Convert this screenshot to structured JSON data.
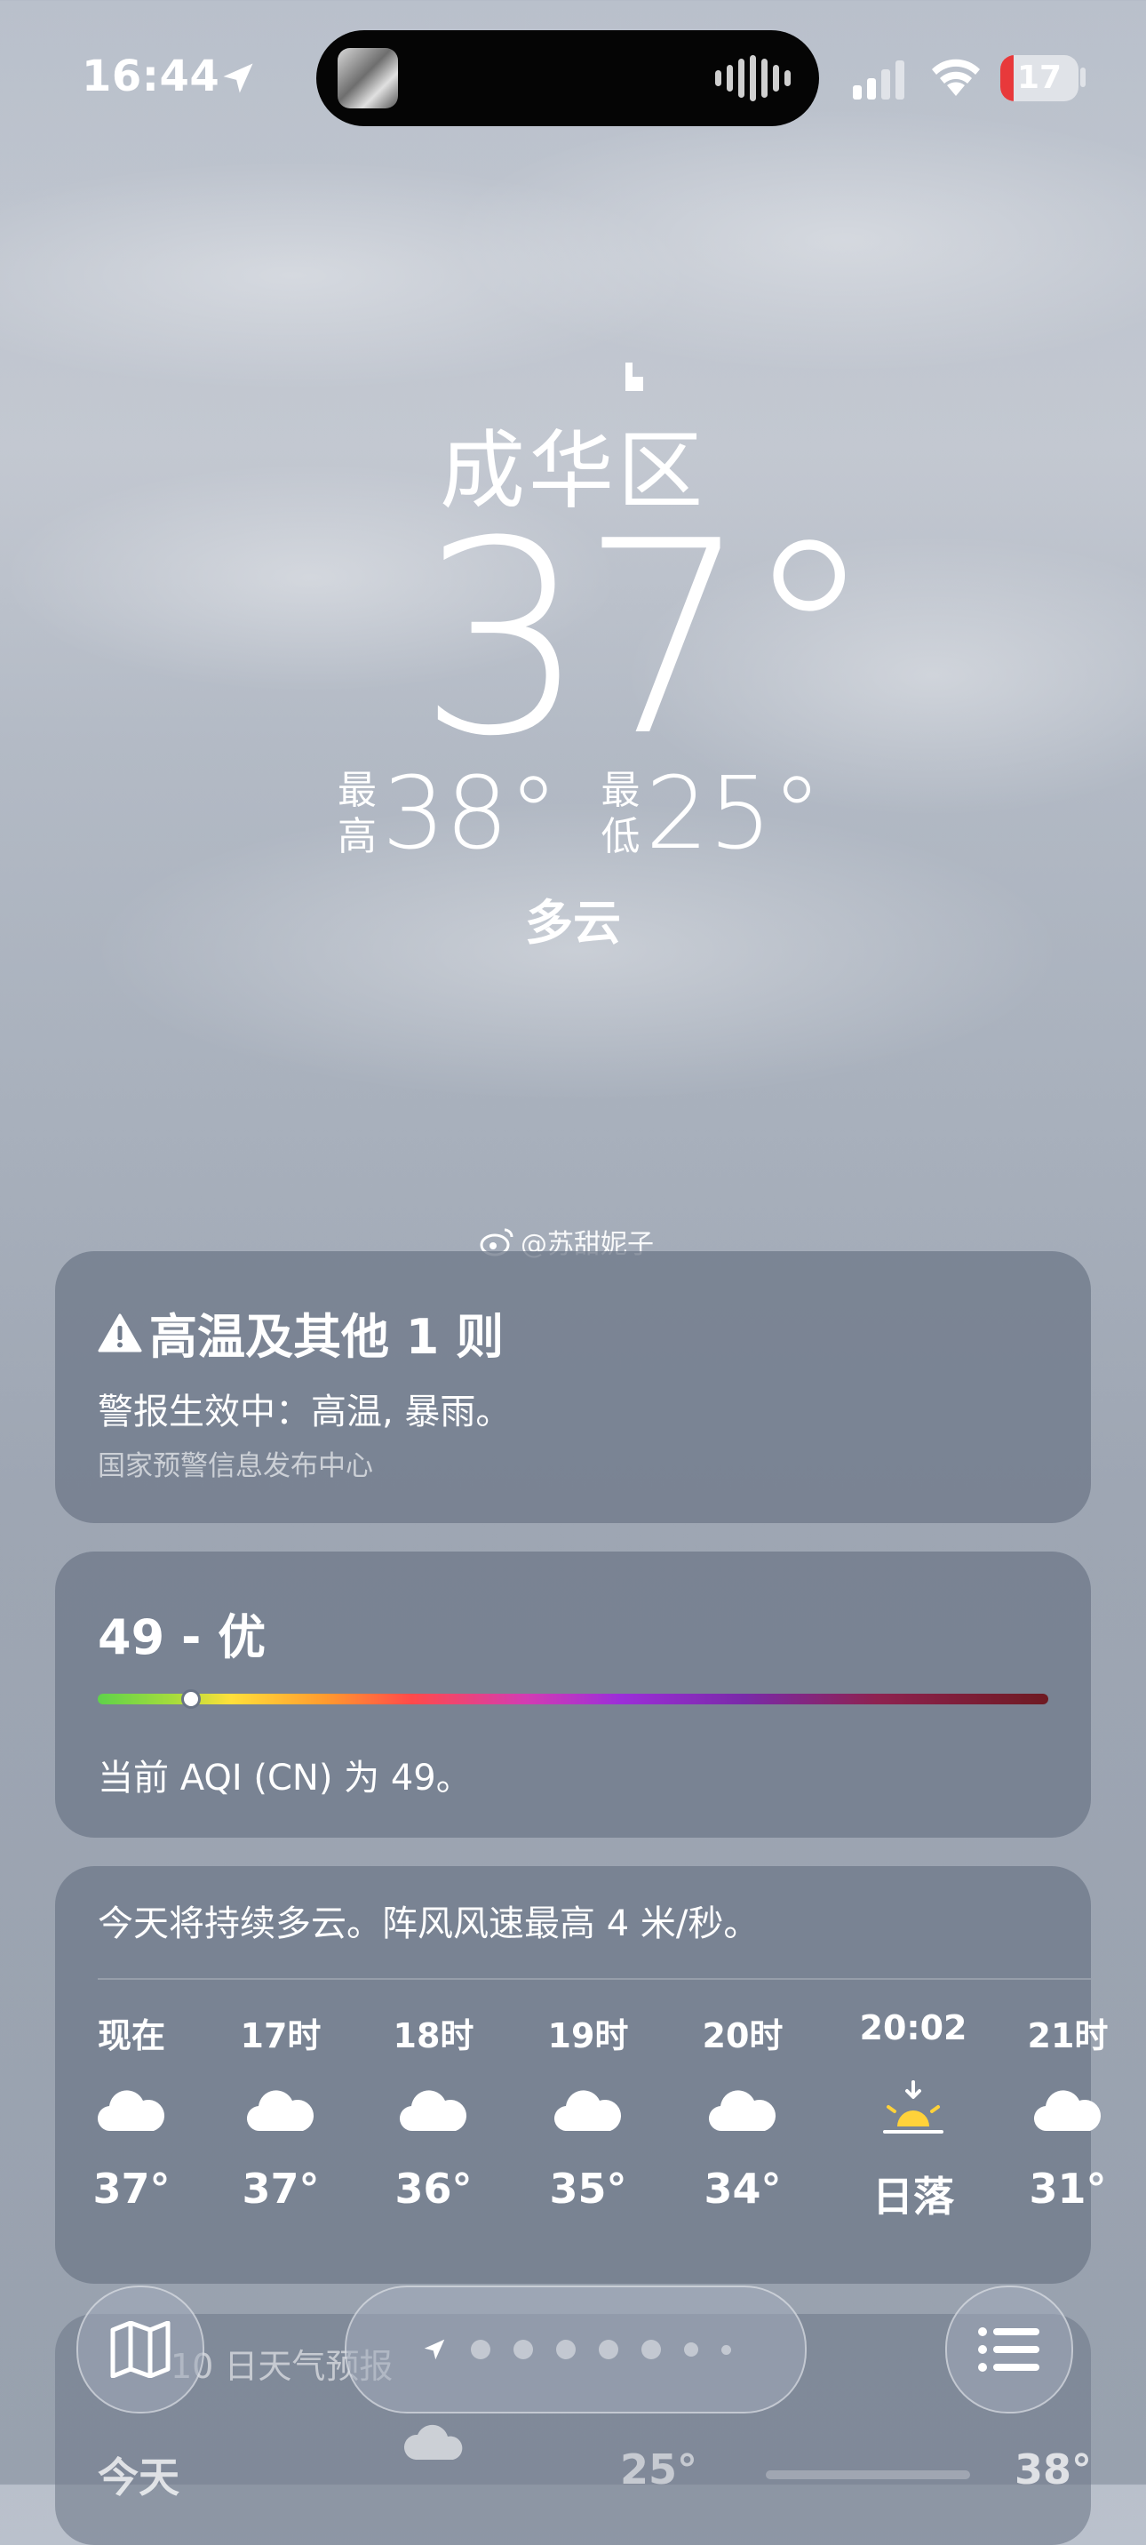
{
  "status_bar": {
    "time": "16:44",
    "battery": "17",
    "battery_level": 0.17,
    "colors": {
      "battery_low": "#e8393b"
    }
  },
  "location": {
    "city": "成华区",
    "temperature": "37°",
    "high_label": "最高",
    "high": "38°",
    "low_label": "最低",
    "low": "25°",
    "condition": "多云"
  },
  "watermark": "@苏甜妮子",
  "alert": {
    "title": "高温及其他 1 则",
    "body": "警报生效中：高温, 暴雨。",
    "source": "国家预警信息发布中心"
  },
  "aqi": {
    "title": "49 - 优",
    "value": 49,
    "scale_max": 500,
    "description": "当前 AQI (CN) 为 49。"
  },
  "hourly": {
    "summary": "今天将持续多云。阵风风速最高 4 米/秒。",
    "items": [
      {
        "time": "现在",
        "icon": "cloud-icon",
        "value": "37°"
      },
      {
        "time": "17时",
        "icon": "cloud-icon",
        "value": "37°"
      },
      {
        "time": "18时",
        "icon": "cloud-icon",
        "value": "36°"
      },
      {
        "time": "19时",
        "icon": "cloud-icon",
        "value": "35°"
      },
      {
        "time": "20时",
        "icon": "cloud-icon",
        "value": "34°"
      },
      {
        "time": "20:02",
        "icon": "sunset-icon",
        "value": "日落"
      },
      {
        "time": "21时",
        "icon": "cloud-icon",
        "value": "31°"
      }
    ]
  },
  "daily": {
    "title": "10 日天气预报",
    "today": "今天",
    "low": "25°",
    "high": "38°"
  },
  "toolbar": {
    "map_icon": "map-icon",
    "list_icon": "list-icon",
    "pages": 8,
    "current_page": 0
  }
}
